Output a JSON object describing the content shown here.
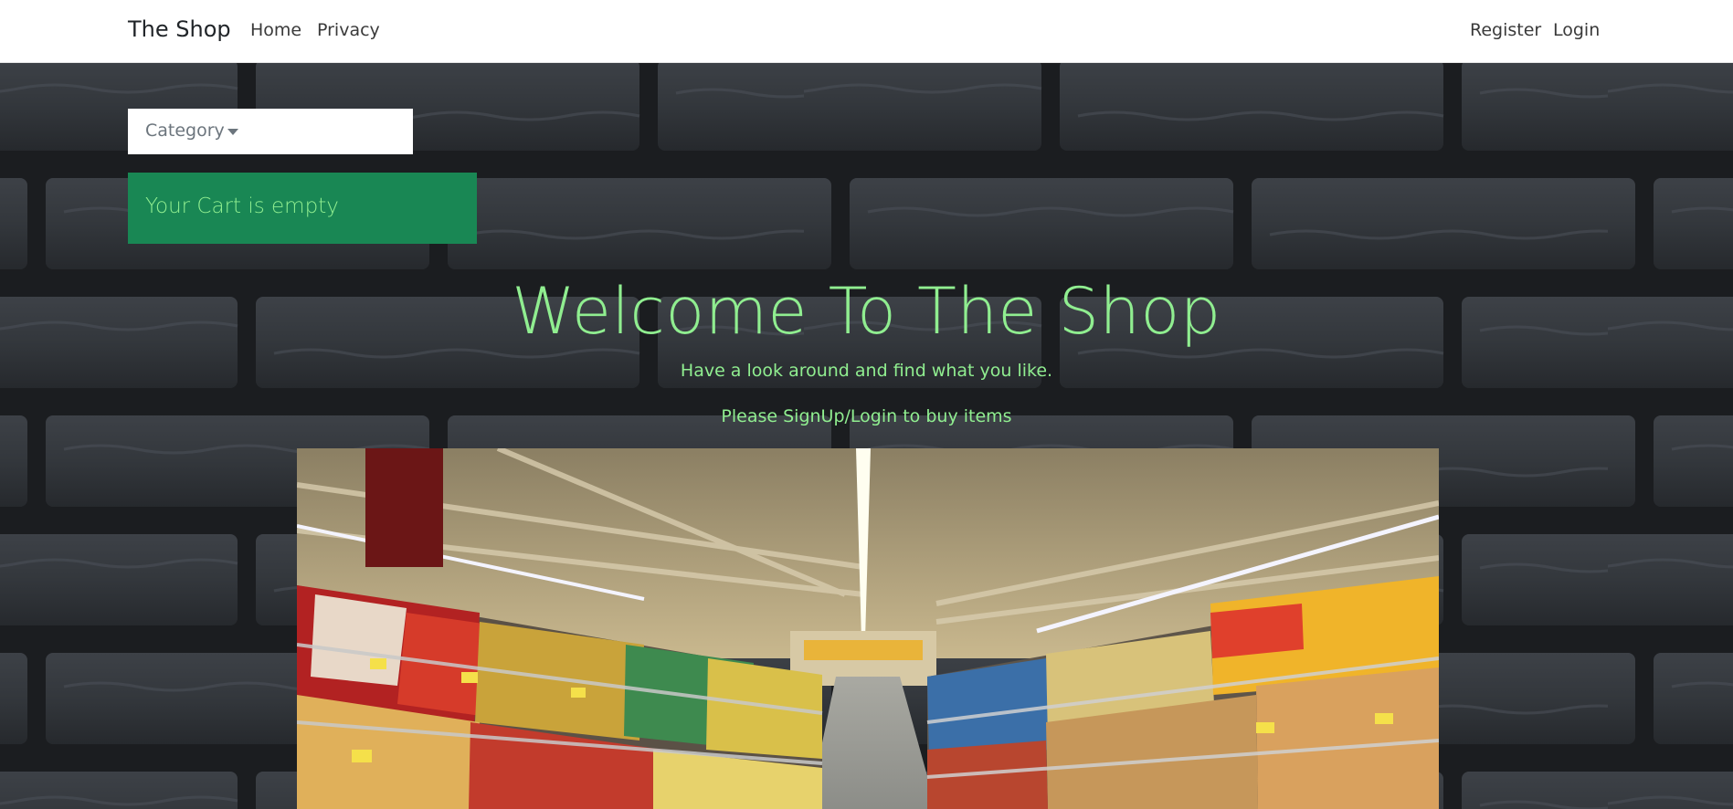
{
  "navbar": {
    "brand": "The Shop",
    "links": [
      "Home",
      "Privacy"
    ],
    "auth": [
      "Register",
      "Login"
    ]
  },
  "category": {
    "label": "Category"
  },
  "cart": {
    "message": "Your Cart is empty"
  },
  "hero": {
    "title": "Welcome To The Shop",
    "subtitle": "Have a look around and find what you like.",
    "note": "Please SignUp/Login to buy items"
  },
  "colors": {
    "accent_text": "#90ee90",
    "cart_bg": "#198754",
    "navbar_bg": "#ffffff",
    "brick": "#2b2f34"
  }
}
